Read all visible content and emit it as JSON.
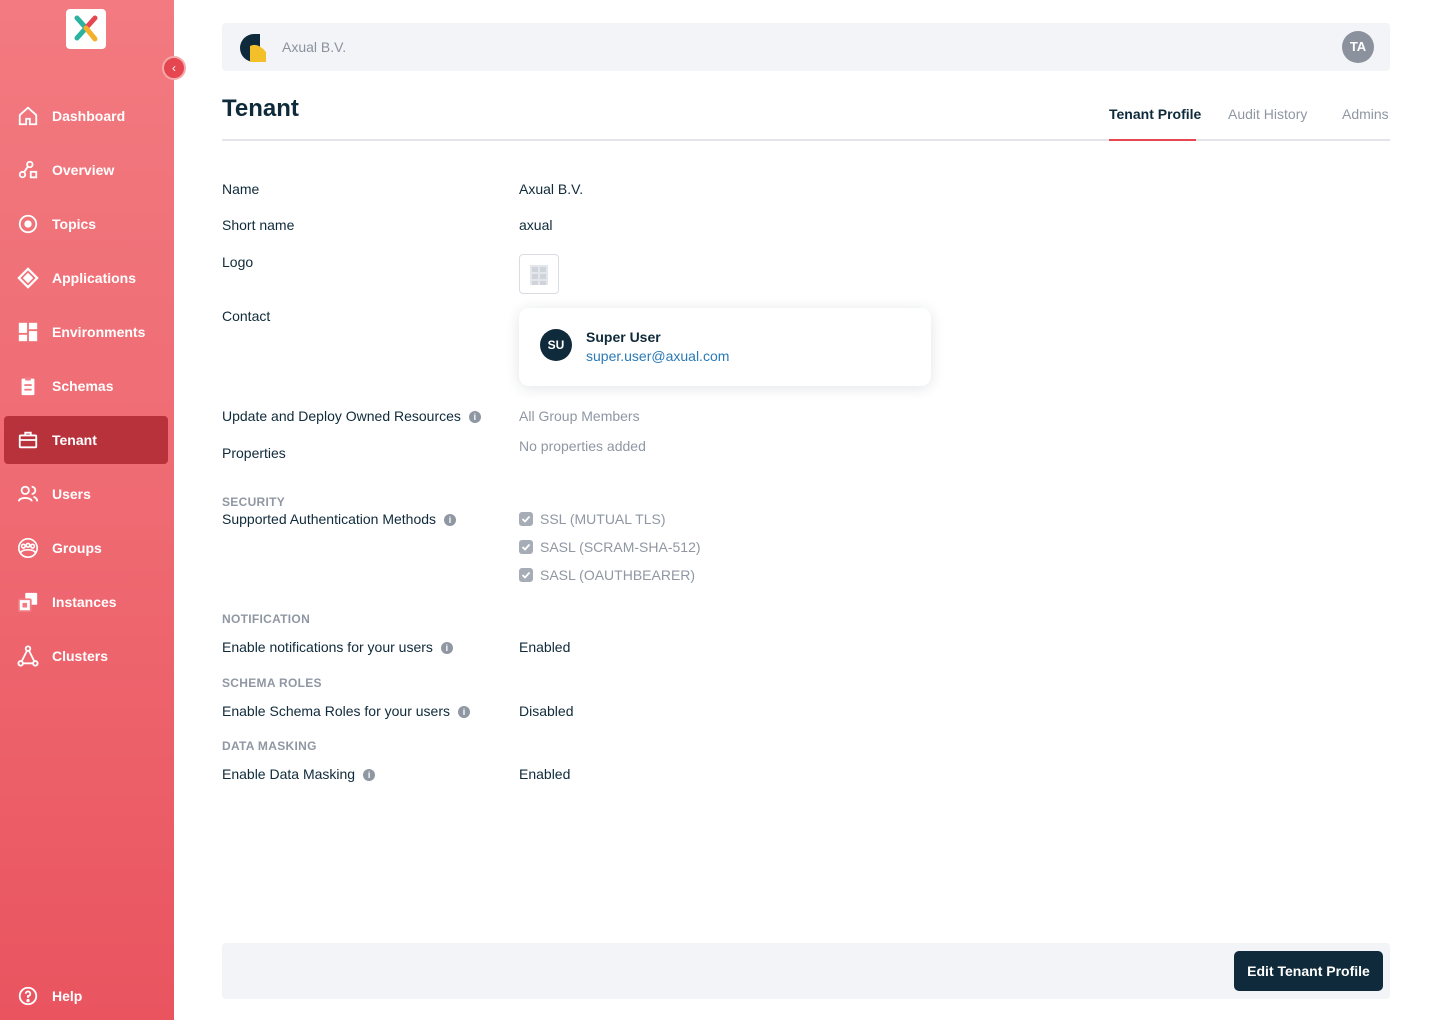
{
  "sidebar": {
    "items": [
      {
        "label": "Dashboard",
        "icon": "home-icon"
      },
      {
        "label": "Overview",
        "icon": "overview-icon"
      },
      {
        "label": "Topics",
        "icon": "topics-icon"
      },
      {
        "label": "Applications",
        "icon": "applications-icon"
      },
      {
        "label": "Environments",
        "icon": "environments-icon"
      },
      {
        "label": "Schemas",
        "icon": "schemas-icon"
      },
      {
        "label": "Tenant",
        "icon": "tenant-icon",
        "active": true
      },
      {
        "label": "Users",
        "icon": "users-icon"
      },
      {
        "label": "Groups",
        "icon": "groups-icon"
      },
      {
        "label": "Instances",
        "icon": "instances-icon"
      },
      {
        "label": "Clusters",
        "icon": "clusters-icon"
      }
    ],
    "help_label": "Help",
    "collapse_glyph": "‹"
  },
  "header": {
    "org_name": "Axual B.V.",
    "user_initials": "TA"
  },
  "page": {
    "title": "Tenant",
    "tabs": [
      {
        "label": "Tenant Profile",
        "active": true
      },
      {
        "label": "Audit History"
      },
      {
        "label": "Admins"
      }
    ]
  },
  "profile": {
    "name_label": "Name",
    "name_value": "Axual B.V.",
    "short_name_label": "Short name",
    "short_name_value": "axual",
    "logo_label": "Logo",
    "contact_label": "Contact",
    "contact": {
      "initials": "SU",
      "name": "Super User",
      "email": "super.user@axual.com"
    },
    "update_deploy_label": "Update and Deploy Owned Resources",
    "update_deploy_value": "All Group Members",
    "properties_label": "Properties",
    "properties_value": "No properties added",
    "security_heading": "SECURITY",
    "auth_methods_label": "Supported Authentication Methods",
    "auth_methods": [
      "SSL (MUTUAL TLS)",
      "SASL (SCRAM-SHA-512)",
      "SASL (OAUTHBEARER)"
    ],
    "notification_heading": "NOTIFICATION",
    "notifications_label": "Enable notifications for your users",
    "notifications_value": "Enabled",
    "schema_roles_heading": "SCHEMA ROLES",
    "schema_roles_label": "Enable Schema Roles for your users",
    "schema_roles_value": "Disabled",
    "data_masking_heading": "DATA MASKING",
    "data_masking_label": "Enable Data Masking",
    "data_masking_value": "Enabled",
    "info_glyph": "i"
  },
  "footer": {
    "edit_label": "Edit Tenant Profile"
  },
  "colors": {
    "sidebar": "#ef6a72",
    "sidebar_active": "#b8323b",
    "primary_dark": "#0f2a3a",
    "accent": "#e5464f",
    "link": "#2a7ab8"
  }
}
